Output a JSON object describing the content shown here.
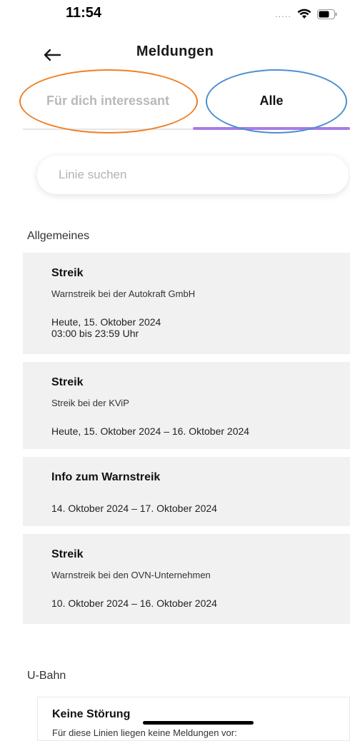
{
  "status": {
    "time": "11:54",
    "signal": "....."
  },
  "nav": {
    "title": "Meldungen"
  },
  "tabs": [
    {
      "label": "Für dich interessant",
      "active": false
    },
    {
      "label": "Alle",
      "active": true
    }
  ],
  "search": {
    "placeholder": "Linie suchen",
    "value": ""
  },
  "sections": {
    "general": {
      "heading": "Allgemeines",
      "items": [
        {
          "title": "Streik",
          "subtitle": "Warnstreik bei der Autokraft GmbH",
          "date_line1": "Heute, 15. Oktober 2024",
          "date_line2": "03:00 bis 23:59 Uhr"
        },
        {
          "title": "Streik",
          "subtitle": "Streik bei der KViP",
          "date": "Heute, 15. Oktober 2024 – 16. Oktober 2024"
        },
        {
          "title": "Info zum Warnstreik",
          "date": "14. Oktober 2024 – 17. Oktober 2024"
        },
        {
          "title": "Streik",
          "subtitle": "Warnstreik bei den OVN-Unternehmen",
          "date": "10. Oktober 2024 – 16. Oktober 2024"
        }
      ]
    },
    "ubahn": {
      "heading": "U-Bahn",
      "title": "Keine Störung",
      "text": "Für diese Linien liegen keine Meldungen vor:"
    }
  },
  "colors": {
    "accent": "#a77be6",
    "annotation_orange": "#ef7f25",
    "annotation_blue": "#4b8fd0",
    "card_bg": "#f1f1f1"
  },
  "icons": {
    "back": "arrow-left-icon",
    "wifi": "wifi-icon",
    "battery": "battery-icon"
  }
}
